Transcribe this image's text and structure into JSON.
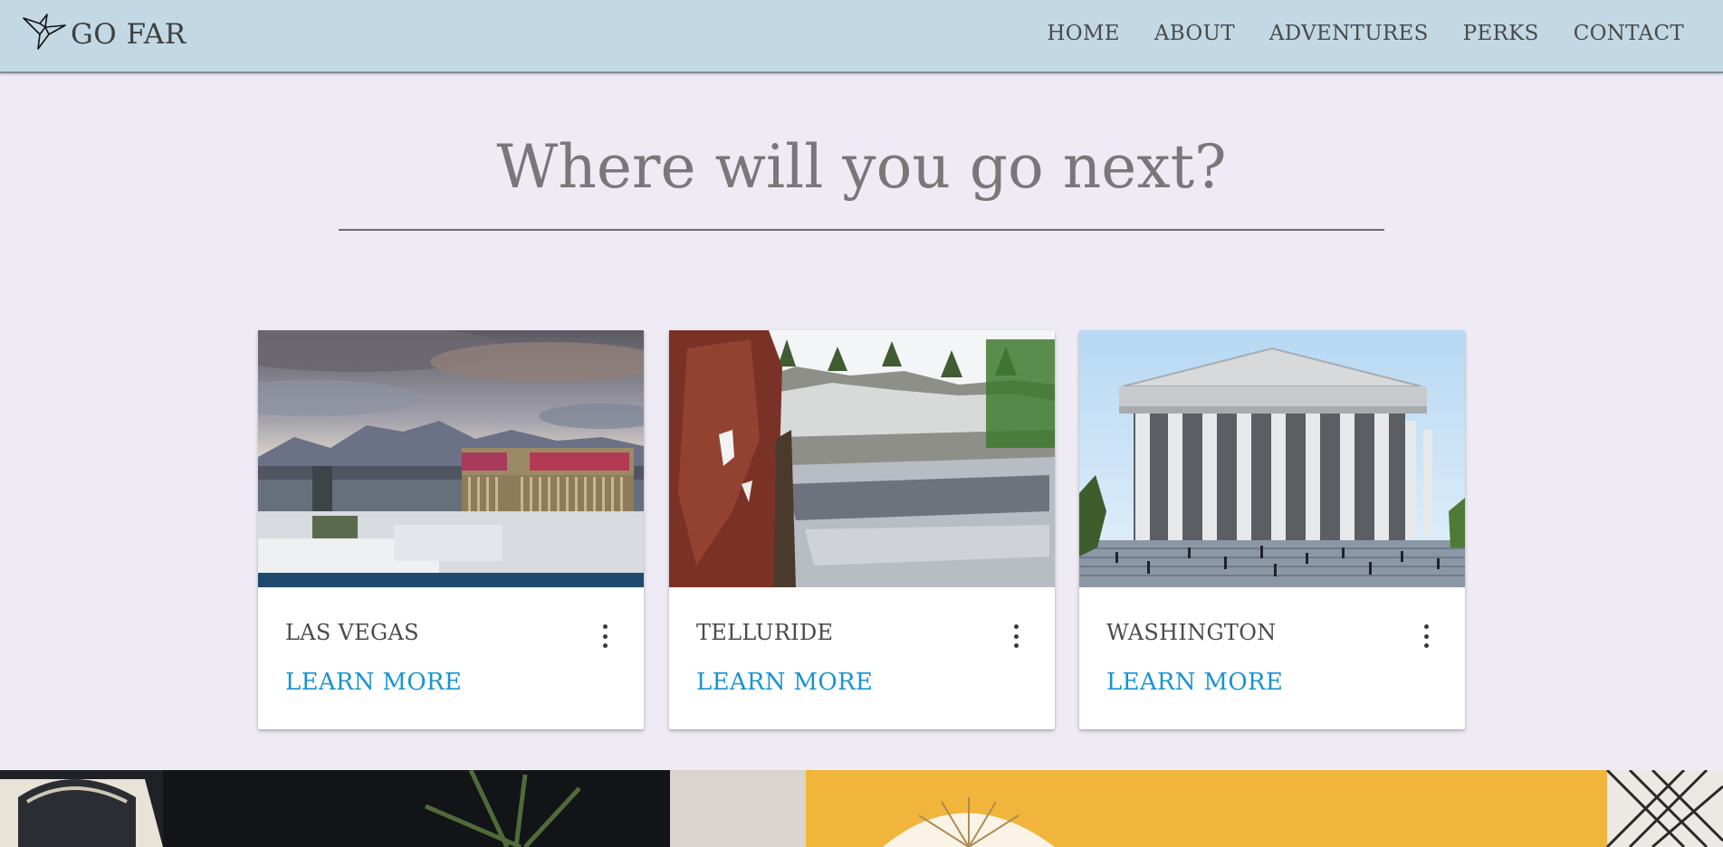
{
  "header": {
    "logo_text": "GO FAR",
    "nav": [
      "HOME",
      "ABOUT",
      "ADVENTURES",
      "PERKS",
      "CONTACT"
    ]
  },
  "hero": {
    "headline": "Where will you go next?"
  },
  "cards": [
    {
      "title": "LAS VEGAS",
      "link": "LEARN MORE",
      "image": "las-vegas-skyline-photo"
    },
    {
      "title": "TELLURIDE",
      "link": "LEARN MORE",
      "image": "snowy-river-gorge-photo"
    },
    {
      "title": "WASHINGTON",
      "link": "LEARN MORE",
      "image": "jefferson-memorial-photo"
    }
  ],
  "colors": {
    "header_bg": "#c2d9e5",
    "page_bg": "#efebf4",
    "link": "#1893d2",
    "text": "#4b4b4b",
    "headline": "#7a7779"
  },
  "icons": {
    "logo": "origami-bird-icon",
    "card_menu": "more-vertical-icon"
  }
}
